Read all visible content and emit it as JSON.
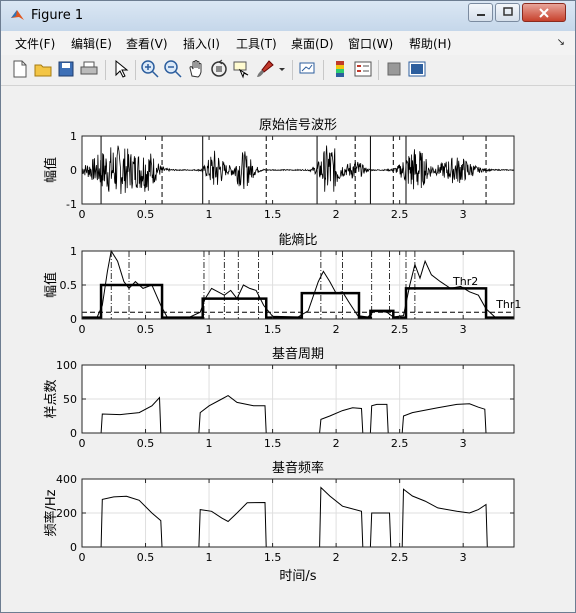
{
  "window": {
    "title": "Figure 1"
  },
  "menu": [
    "文件(F)",
    "编辑(E)",
    "查看(V)",
    "插入(I)",
    "工具(T)",
    "桌面(D)",
    "窗口(W)",
    "帮助(H)"
  ],
  "toolbar_icons": [
    "new-figure-icon",
    "open-file-icon",
    "save-icon",
    "print-icon",
    "edit-plot-icon",
    "zoom-in-icon",
    "zoom-out-icon",
    "pan-icon",
    "rotate-3d-icon",
    "data-cursor-icon",
    "brush-icon",
    "link-plot-icon",
    "colorbar-icon",
    "legend-icon",
    "hide-plot-tools-icon",
    "show-plot-tools-icon"
  ],
  "colors": {
    "accent": "#000000",
    "titlebar": "#c5d7ea",
    "close": "#c7412c",
    "grid": "#dfdfdf"
  },
  "chart_data": [
    {
      "type": "line",
      "title": "原始信号波形",
      "ylabel": "幅值",
      "xlabel": "",
      "xlim": [
        0,
        3.4
      ],
      "ylim": [
        -1,
        1
      ],
      "xticks": [
        "0",
        "0.5",
        "1",
        "1.5",
        "2",
        "2.5",
        "3"
      ],
      "yticks": [
        "-1",
        "0",
        "1"
      ],
      "segments_solid_start": [
        0.15,
        0.95,
        1.85,
        2.27,
        2.55
      ],
      "segments_dashed_end": [
        0.63,
        1.45,
        2.15,
        2.45,
        3.18
      ],
      "bursts": [
        [
          0.27,
          0.3,
          0.75
        ],
        [
          0.52,
          0.12,
          0.45
        ],
        [
          1.05,
          0.1,
          0.6
        ],
        [
          1.27,
          0.12,
          0.55
        ],
        [
          1.95,
          0.12,
          0.8
        ],
        [
          2.15,
          0.1,
          0.3
        ],
        [
          2.62,
          0.15,
          0.7
        ],
        [
          2.95,
          0.2,
          0.4
        ]
      ]
    },
    {
      "type": "line",
      "title": "能熵比",
      "ylabel": "幅值",
      "xlabel": "",
      "xlim": [
        0,
        3.4
      ],
      "ylim": [
        0,
        1
      ],
      "xticks": [
        "0",
        "0.5",
        "1",
        "1.5",
        "2",
        "2.5",
        "3"
      ],
      "yticks": [
        "0",
        "0.5",
        "1"
      ],
      "thresholds": [
        {
          "name": "Thr2",
          "value": 0.44
        },
        {
          "name": "Thr1",
          "value": 0.1
        }
      ],
      "dashdot_markers": [
        0.23,
        0.37,
        0.96,
        1.12,
        1.23,
        1.39,
        1.88,
        2.05,
        2.28,
        2.42,
        2.55,
        2.62
      ],
      "blocks": [
        [
          0.15,
          0.63,
          0.5
        ],
        [
          0.95,
          1.45,
          0.3
        ],
        [
          1.73,
          2.18,
          0.38
        ],
        [
          2.27,
          2.45,
          0.12
        ],
        [
          2.55,
          3.18,
          0.45
        ]
      ],
      "curve": [
        [
          0,
          0.02
        ],
        [
          0.12,
          0.03
        ],
        [
          0.16,
          0.2
        ],
        [
          0.2,
          0.7
        ],
        [
          0.23,
          1.0
        ],
        [
          0.28,
          0.85
        ],
        [
          0.33,
          0.55
        ],
        [
          0.37,
          0.45
        ],
        [
          0.42,
          0.55
        ],
        [
          0.48,
          0.45
        ],
        [
          0.55,
          0.5
        ],
        [
          0.62,
          0.2
        ],
        [
          0.67,
          0.03
        ],
        [
          0.85,
          0.03
        ],
        [
          0.93,
          0.1
        ],
        [
          0.97,
          0.3
        ],
        [
          1.02,
          0.45
        ],
        [
          1.07,
          0.4
        ],
        [
          1.12,
          0.35
        ],
        [
          1.17,
          0.42
        ],
        [
          1.22,
          0.3
        ],
        [
          1.27,
          0.5
        ],
        [
          1.32,
          0.45
        ],
        [
          1.37,
          0.42
        ],
        [
          1.43,
          0.2
        ],
        [
          1.5,
          0.04
        ],
        [
          1.7,
          0.03
        ],
        [
          1.78,
          0.12
        ],
        [
          1.86,
          0.55
        ],
        [
          1.9,
          0.7
        ],
        [
          1.95,
          0.55
        ],
        [
          2.0,
          0.38
        ],
        [
          2.05,
          0.4
        ],
        [
          2.1,
          0.25
        ],
        [
          2.17,
          0.05
        ],
        [
          2.25,
          0.03
        ],
        [
          2.3,
          0.12
        ],
        [
          2.4,
          0.1
        ],
        [
          2.45,
          0.03
        ],
        [
          2.53,
          0.05
        ],
        [
          2.58,
          0.5
        ],
        [
          2.62,
          0.8
        ],
        [
          2.66,
          0.6
        ],
        [
          2.7,
          0.85
        ],
        [
          2.75,
          0.65
        ],
        [
          2.82,
          0.55
        ],
        [
          2.9,
          0.45
        ],
        [
          2.98,
          0.48
        ],
        [
          3.05,
          0.4
        ],
        [
          3.12,
          0.35
        ],
        [
          3.18,
          0.15
        ],
        [
          3.25,
          0.03
        ],
        [
          3.4,
          0.02
        ]
      ]
    },
    {
      "type": "line",
      "title": "基音周期",
      "ylabel": "样点数",
      "xlabel": "",
      "xlim": [
        0,
        3.4
      ],
      "ylim": [
        0,
        100
      ],
      "xticks": [
        "0",
        "0.5",
        "1",
        "1.5",
        "2",
        "2.5",
        "3"
      ],
      "yticks": [
        "0",
        "50",
        "100"
      ],
      "curve": [
        [
          0,
          0
        ],
        [
          0.15,
          0
        ],
        [
          0.16,
          28
        ],
        [
          0.3,
          27
        ],
        [
          0.45,
          30
        ],
        [
          0.55,
          40
        ],
        [
          0.61,
          52
        ],
        [
          0.62,
          0
        ],
        [
          0.92,
          0
        ],
        [
          0.93,
          30
        ],
        [
          1.0,
          40
        ],
        [
          1.1,
          50
        ],
        [
          1.15,
          55
        ],
        [
          1.22,
          45
        ],
        [
          1.35,
          40
        ],
        [
          1.44,
          40
        ],
        [
          1.45,
          0
        ],
        [
          1.87,
          0
        ],
        [
          1.88,
          20
        ],
        [
          1.95,
          25
        ],
        [
          2.05,
          33
        ],
        [
          2.13,
          37
        ],
        [
          2.2,
          36
        ],
        [
          2.21,
          0
        ],
        [
          2.27,
          0
        ],
        [
          2.28,
          40
        ],
        [
          2.32,
          42
        ],
        [
          2.4,
          42
        ],
        [
          2.41,
          0
        ],
        [
          2.52,
          0
        ],
        [
          2.53,
          25
        ],
        [
          2.6,
          30
        ],
        [
          2.8,
          37
        ],
        [
          2.95,
          42
        ],
        [
          3.05,
          43
        ],
        [
          3.12,
          38
        ],
        [
          3.17,
          35
        ],
        [
          3.18,
          0
        ],
        [
          3.4,
          0
        ]
      ]
    },
    {
      "type": "line",
      "title": "基音频率",
      "ylabel": "频率/Hz",
      "xlabel": "时间/s",
      "xlim": [
        0,
        3.4
      ],
      "ylim": [
        0,
        400
      ],
      "xticks": [
        "0",
        "0.5",
        "1",
        "1.5",
        "2",
        "2.5",
        "3"
      ],
      "yticks": [
        "0",
        "200",
        "400"
      ],
      "curve": [
        [
          0,
          0
        ],
        [
          0.15,
          0
        ],
        [
          0.16,
          280
        ],
        [
          0.25,
          295
        ],
        [
          0.35,
          298
        ],
        [
          0.45,
          275
        ],
        [
          0.55,
          200
        ],
        [
          0.62,
          155
        ],
        [
          0.63,
          0
        ],
        [
          0.92,
          0
        ],
        [
          0.93,
          220
        ],
        [
          1.02,
          210
        ],
        [
          1.1,
          170
        ],
        [
          1.15,
          150
        ],
        [
          1.22,
          200
        ],
        [
          1.3,
          260
        ],
        [
          1.44,
          262
        ],
        [
          1.45,
          0
        ],
        [
          1.87,
          0
        ],
        [
          1.88,
          350
        ],
        [
          1.95,
          300
        ],
        [
          2.05,
          240
        ],
        [
          2.1,
          230
        ],
        [
          2.2,
          210
        ],
        [
          2.21,
          0
        ],
        [
          2.27,
          0
        ],
        [
          2.28,
          200
        ],
        [
          2.33,
          200
        ],
        [
          2.42,
          200
        ],
        [
          2.43,
          0
        ],
        [
          2.52,
          0
        ],
        [
          2.53,
          340
        ],
        [
          2.6,
          300
        ],
        [
          2.7,
          270
        ],
        [
          2.8,
          230
        ],
        [
          2.95,
          210
        ],
        [
          3.05,
          200
        ],
        [
          3.12,
          220
        ],
        [
          3.18,
          250
        ],
        [
          3.19,
          0
        ],
        [
          3.4,
          0
        ]
      ]
    }
  ]
}
